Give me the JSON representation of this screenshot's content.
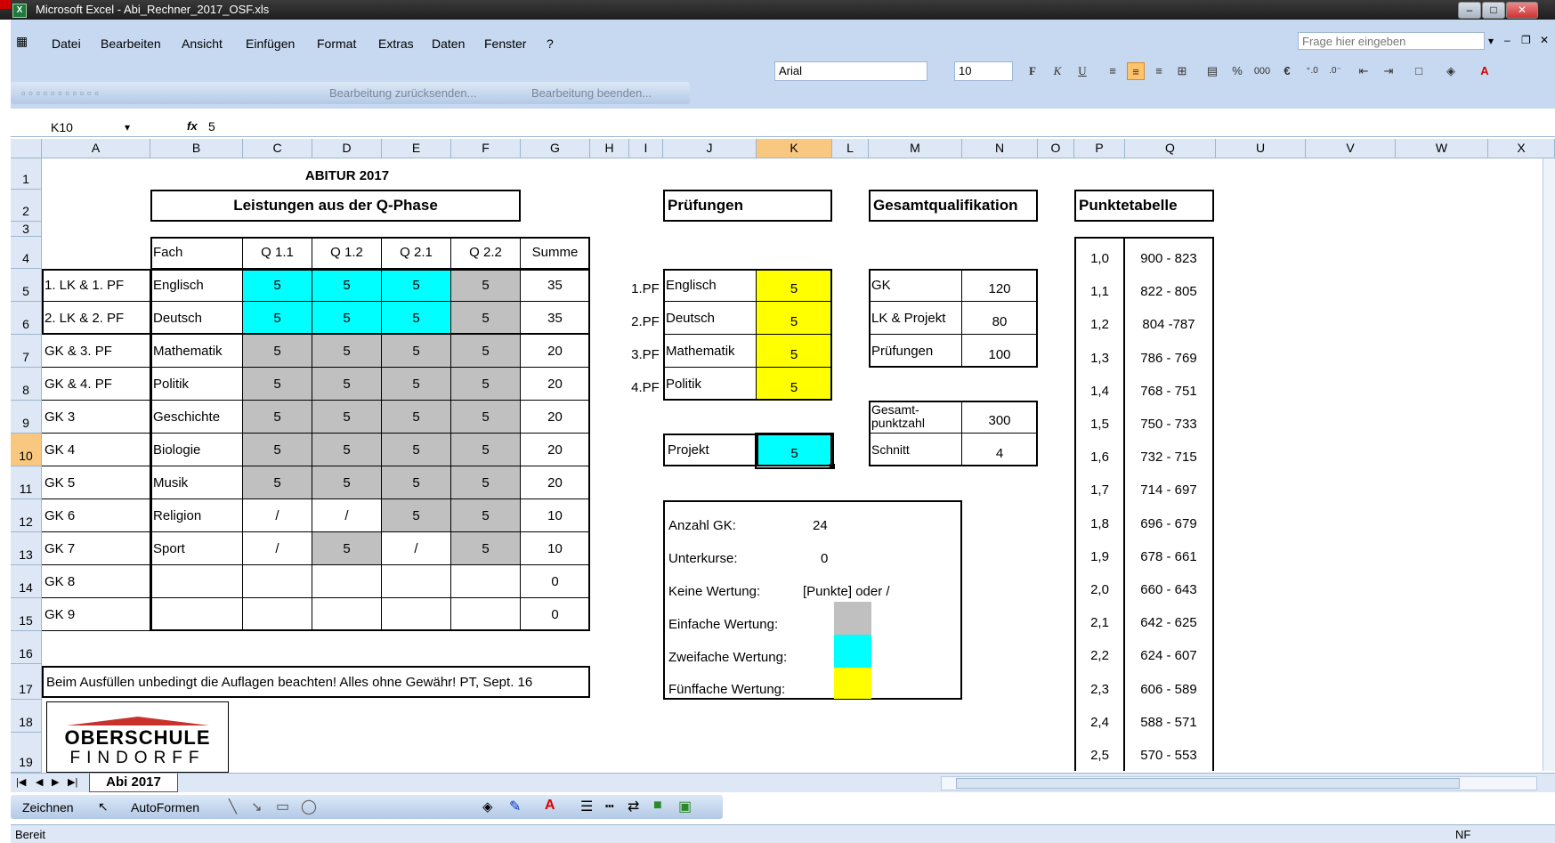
{
  "window": {
    "title": "Microsoft Excel - Abi_Rechner_2017_OSF.xls",
    "min": "–",
    "max": "□",
    "close": "✕"
  },
  "menu": [
    "Datei",
    "Bearbeiten",
    "Ansicht",
    "Einfügen",
    "Format",
    "Extras",
    "Daten",
    "Fenster",
    "?"
  ],
  "ask_placeholder": "Frage hier eingeben",
  "toolbar": {
    "font": "Arial",
    "size": "10",
    "bold": "F",
    "italic": "K",
    "underline": "U",
    "percent": "%",
    "thousands": "000",
    "euro": "€"
  },
  "review_toolbar": {
    "send_back": "Bearbeitung zurücksenden...",
    "end": "Bearbeitung beenden..."
  },
  "formula": {
    "cell": "K10",
    "fx": "fx",
    "value": "5"
  },
  "columns": [
    "A",
    "B",
    "C",
    "D",
    "E",
    "F",
    "G",
    "H",
    "I",
    "J",
    "K",
    "L",
    "M",
    "N",
    "O",
    "P",
    "Q",
    "U",
    "V",
    "W",
    "X"
  ],
  "rows": [
    "1",
    "2",
    "3",
    "4",
    "5",
    "6",
    "7",
    "8",
    "9",
    "10",
    "11",
    "12",
    "13",
    "14",
    "15",
    "16",
    "17",
    "18",
    "19"
  ],
  "sheet": {
    "title": "ABITUR 2017",
    "q_title": "Leistungen aus der Q-Phase",
    "headers": [
      "Fach",
      "Q 1.1",
      "Q 1.2",
      "Q 2.1",
      "Q 2.2",
      "Summe"
    ],
    "courses": [
      [
        "1. LK & 1. PF",
        "Englisch",
        "5",
        "5",
        "5",
        "5",
        "35"
      ],
      [
        "2. LK & 2. PF",
        "Deutsch",
        "5",
        "5",
        "5",
        "5",
        "35"
      ],
      [
        "GK & 3. PF",
        "Mathematik",
        "5",
        "5",
        "5",
        "5",
        "20"
      ],
      [
        "GK & 4. PF",
        "Politik",
        "5",
        "5",
        "5",
        "5",
        "20"
      ],
      [
        "GK 3",
        "Geschichte",
        "5",
        "5",
        "5",
        "5",
        "20"
      ],
      [
        "GK 4",
        "Biologie",
        "5",
        "5",
        "5",
        "5",
        "20"
      ],
      [
        "GK 5",
        "Musik",
        "5",
        "5",
        "5",
        "5",
        "20"
      ],
      [
        "GK 6",
        "Religion",
        "/",
        "/",
        "5",
        "5",
        "10"
      ],
      [
        "GK 7",
        "Sport",
        "/",
        "5",
        "/",
        "5",
        "10"
      ],
      [
        "GK 8",
        "",
        "",
        "",
        "",
        "",
        "0"
      ],
      [
        "GK 9",
        "",
        "",
        "",
        "",
        "",
        "0"
      ]
    ],
    "note": "Beim Ausfüllen unbedingt die Auflagen beachten! Alles ohne Gewähr! PT, Sept. 16",
    "pruefungen_title": "Prüfungen",
    "pruefungen": [
      [
        "1.PF",
        "Englisch",
        "5"
      ],
      [
        "2.PF",
        "Deutsch",
        "5"
      ],
      [
        "3.PF",
        "Mathematik",
        "5"
      ],
      [
        "4.PF",
        "Politik",
        "5"
      ]
    ],
    "projekt": [
      "Projekt",
      "5"
    ],
    "gesamt_title": "Gesamtqualifikation",
    "gesamt": [
      [
        "GK",
        "120"
      ],
      [
        "LK & Projekt",
        "80"
      ],
      [
        "Prüfungen",
        "100"
      ]
    ],
    "gesamt2": [
      [
        "Gesamt-punktzahl",
        "300"
      ],
      [
        "Schnitt",
        "4"
      ]
    ],
    "legend": {
      "anzahl_gk_label": "Anzahl GK:",
      "anzahl_gk": "24",
      "unterkurse_label": "Unterkurse:",
      "unterkurse": "0",
      "keine_label": "Keine Wertung:",
      "keine": "[Punkte] oder /",
      "einfach": "Einfache Wertung:",
      "zweifach": "Zweifache Wertung:",
      "fuenffach": "Fünffache Wertung:"
    },
    "punkte_title": "Punktetabelle",
    "punkte": [
      [
        "1,0",
        "900 - 823"
      ],
      [
        "1,1",
        "822 - 805"
      ],
      [
        "1,2",
        "804 -787"
      ],
      [
        "1,3",
        "786 - 769"
      ],
      [
        "1,4",
        "768 - 751"
      ],
      [
        "1,5",
        "750 - 733"
      ],
      [
        "1,6",
        "732 - 715"
      ],
      [
        "1,7",
        "714 - 697"
      ],
      [
        "1,8",
        "696 - 679"
      ],
      [
        "1,9",
        "678 - 661"
      ],
      [
        "2,0",
        "660 - 643"
      ],
      [
        "2,1",
        "642 - 625"
      ],
      [
        "2,2",
        "624 - 607"
      ],
      [
        "2,3",
        "606 - 589"
      ],
      [
        "2,4",
        "588 - 571"
      ],
      [
        "2,5",
        "570 - 553"
      ]
    ],
    "logo_line1": "OBERSCHULE",
    "logo_line2": "FINDORFF"
  },
  "tabs": {
    "active": "Abi 2017"
  },
  "drawing": {
    "zeichnen": "Zeichnen",
    "autoformen": "AutoFormen"
  },
  "status": {
    "ready": "Bereit",
    "nf": "NF"
  },
  "colors": {
    "grey": "#c0c0c0",
    "cyan": "#00ffff",
    "yellow": "#ffff00",
    "selection": "#f8c880"
  }
}
